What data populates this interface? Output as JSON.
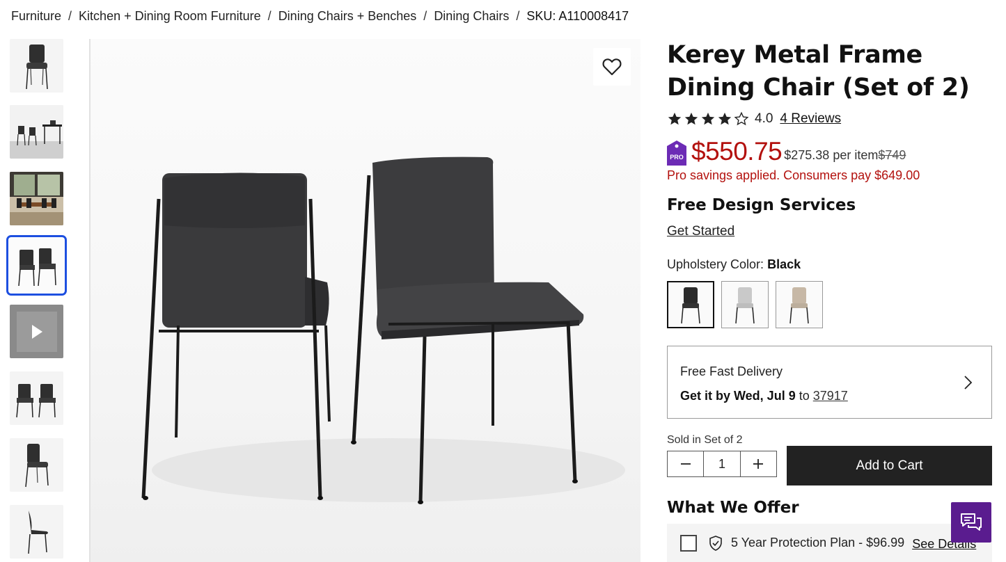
{
  "breadcrumb": {
    "items": [
      "Furniture",
      "Kitchen + Dining Room Furniture",
      "Dining Chairs + Benches",
      "Dining Chairs"
    ],
    "separator": "/",
    "sku": "SKU: A110008417"
  },
  "gallery": {
    "thumbnails": [
      {
        "kind": "chair-front"
      },
      {
        "kind": "room-scene"
      },
      {
        "kind": "dining-room"
      },
      {
        "kind": "pair",
        "selected": true
      },
      {
        "kind": "video"
      },
      {
        "kind": "pair-angle"
      },
      {
        "kind": "side"
      },
      {
        "kind": "profile"
      }
    ],
    "selected_index": 3
  },
  "product": {
    "title": "Kerey Metal Frame Dining Chair (Set of 2)",
    "rating": "4.0",
    "rating_value": 4.0,
    "rating_max": 5,
    "reviews_label": "4 Reviews",
    "price": "$550.75",
    "per_item": "$275.38 per item",
    "original_price": "$749",
    "pro_savings": "Pro savings applied. Consumers pay $649.00",
    "pro_badge": "PRO"
  },
  "design_services": {
    "heading": "Free Design Services",
    "link": "Get Started"
  },
  "color": {
    "label": "Upholstery Color:",
    "selected": "Black",
    "swatches": [
      {
        "name": "Black",
        "color": "#2b2b2b",
        "selected": true
      },
      {
        "name": "Light Gray",
        "color": "#c9c9c9",
        "selected": false
      },
      {
        "name": "Beige",
        "color": "#c7b8a6",
        "selected": false
      }
    ]
  },
  "delivery": {
    "title": "Free Fast Delivery",
    "date_text": "Get it by Wed, Jul 9",
    "to_text": "to",
    "zip": "37917"
  },
  "cart": {
    "sold_in": "Sold in Set of 2",
    "quantity": "1",
    "add_label": "Add to Cart"
  },
  "offer": {
    "heading": "What We Offer",
    "protection_text": "5 Year Protection Plan - $96.99",
    "see_details": "See Details"
  },
  "colors": {
    "price_red": "#b3110e",
    "pro_purple": "#6c2bb5",
    "chat_purple": "#5a1c8f",
    "selected_blue": "#1d4fe0",
    "button_dark": "#222222"
  }
}
